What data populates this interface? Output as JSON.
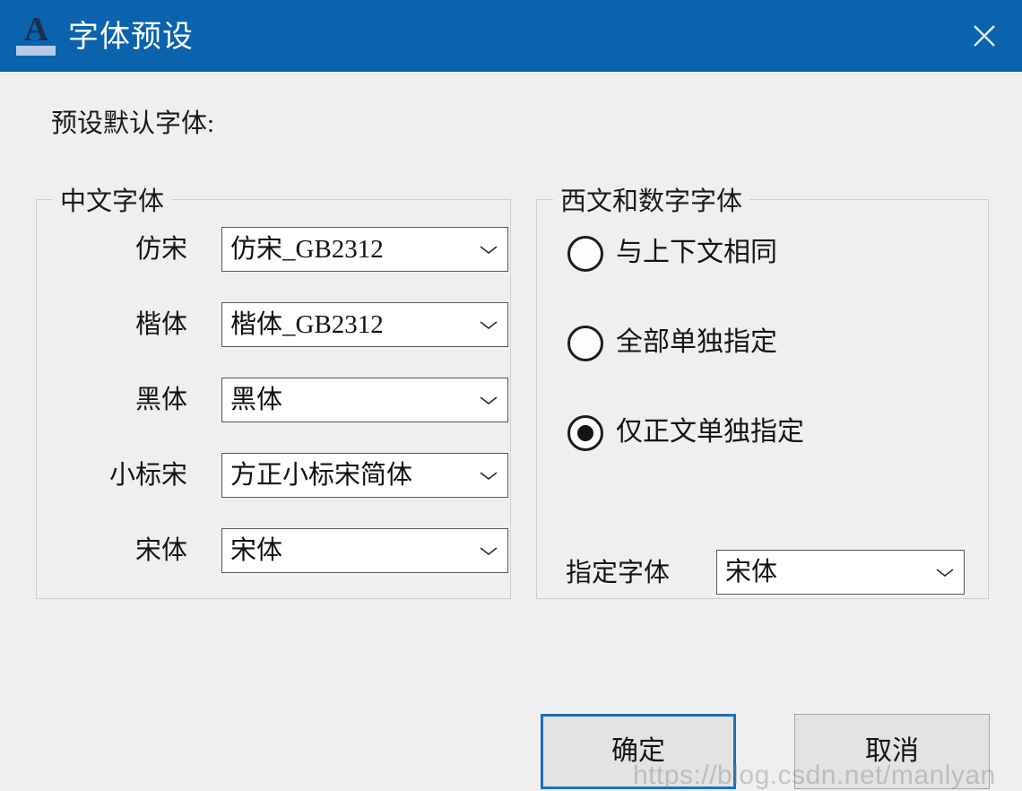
{
  "window": {
    "title": "字体预设",
    "icon": "autocad-a-icon",
    "close_icon": "close-icon",
    "titlebar_color": "#0a63ac",
    "background_color": "#efeff1"
  },
  "main": {
    "preset_label": "预设默认字体:"
  },
  "chinese_group": {
    "legend": "中文字体",
    "rows": [
      {
        "label": "仿宋",
        "value": "仿宋_GB2312"
      },
      {
        "label": "楷体",
        "value": "楷体_GB2312"
      },
      {
        "label": "黑体",
        "value": "黑体"
      },
      {
        "label": "小标宋",
        "value": "方正小标宋简体"
      },
      {
        "label": "宋体",
        "value": "宋体"
      }
    ]
  },
  "western_group": {
    "legend": "西文和数字字体",
    "radios": [
      {
        "label": "与上下文相同",
        "checked": false
      },
      {
        "label": "全部单独指定",
        "checked": false
      },
      {
        "label": "仅正文单独指定",
        "checked": true
      }
    ],
    "assigned_font": {
      "label": "指定字体",
      "value": "宋体"
    }
  },
  "buttons": {
    "ok": "确定",
    "cancel": "取消",
    "ok_focus_color": "#1d6fb8"
  },
  "watermark": {
    "text": "https://blog.csdn.net/manlyan"
  }
}
